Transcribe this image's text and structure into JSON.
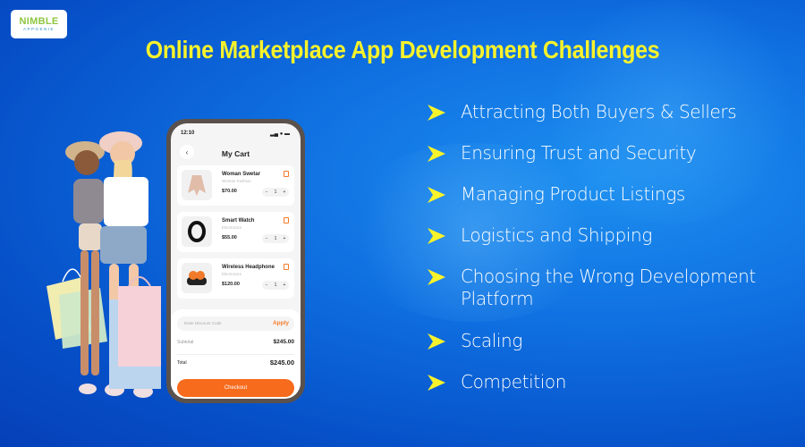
{
  "brand": {
    "logo_line1": "NIMBLE",
    "logo_line2": "APPGENIE"
  },
  "title": "Online Marketplace App Development Challenges",
  "colors": {
    "title": "#f8f32b",
    "accent": "#f76b1c",
    "arrow": "#f8f32b",
    "logo_green": "#8dc63f"
  },
  "challenges": [
    {
      "icon": "arrow-bullet-icon",
      "text": "Attracting Both Buyers & Sellers"
    },
    {
      "icon": "arrow-bullet-icon",
      "text": "Ensuring Trust and Security"
    },
    {
      "icon": "arrow-bullet-icon",
      "text": "Managing Product Listings"
    },
    {
      "icon": "arrow-bullet-icon",
      "text": "Logistics and Shipping"
    },
    {
      "icon": "arrow-bullet-icon",
      "text": "Choosing the Wrong Development Platform"
    },
    {
      "icon": "arrow-bullet-icon",
      "text": "Scaling"
    },
    {
      "icon": "arrow-bullet-icon",
      "text": "Competition"
    }
  ],
  "phone": {
    "time": "12:10",
    "header": "My Cart",
    "back_icon": "‹",
    "items": [
      {
        "name": "Woman Swetar",
        "category": "Woman Fashion",
        "price": "$70.00",
        "qty": "1"
      },
      {
        "name": "Smart Watch",
        "category": "Electronics",
        "price": "$55.00",
        "qty": "1"
      },
      {
        "name": "Wireless Headphone",
        "category": "Electronics",
        "price": "$120.00",
        "qty": "1"
      }
    ],
    "minus": "−",
    "plus": "+",
    "discount_placeholder": "Enter Discount Code",
    "apply_label": "Apply",
    "subtotal_label": "Subtotal",
    "subtotal_value": "$245.00",
    "total_label": "Total",
    "total_value": "$245.00",
    "checkout_label": "Checkout"
  }
}
